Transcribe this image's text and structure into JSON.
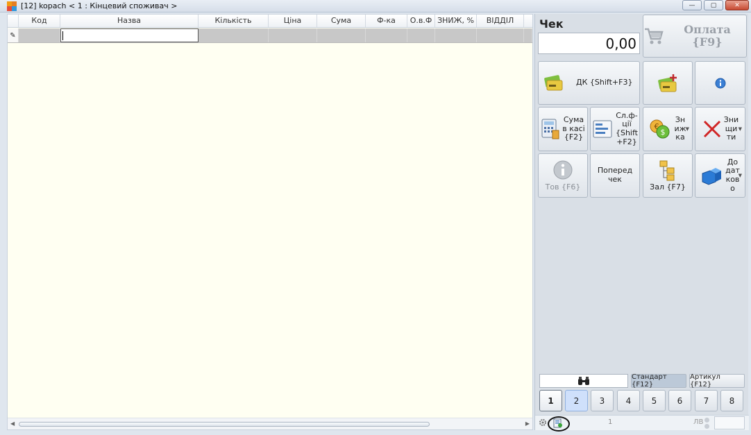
{
  "window": {
    "title": "[12] kopach <    1 : Кінцевий споживач >",
    "minimize_icon": "minimize-icon",
    "maximize_icon": "maximize-icon",
    "close_icon": "close-icon",
    "close_glyph": "✕",
    "minimize_glyph": "—",
    "maximize_glyph": "▢"
  },
  "grid": {
    "columns": [
      "Код",
      "Назва",
      "Кількість",
      "Ціна",
      "Сума",
      "Ф-ка",
      "О.в.Ф",
      "ЗНИЖ, %",
      "ВІДДІЛ"
    ],
    "row_indicator": "✎"
  },
  "panel": {
    "check_label": "Чек",
    "total": "0,00",
    "pay_label": "Оплата {F9}",
    "buttons": {
      "dk": "ДК {Shift+F3}",
      "suma_v_kasi": "Сума\nв касі\n{F2}",
      "sl_fiji": "Сл.ф-\nції\n{Shift\n+F2}",
      "znyzhka": "Зн\nиж\nка",
      "znyshchyty": "Зни\nщи\nти",
      "tov": "Тов {F6}",
      "poperedchek": "Поперед чек",
      "zal": "Зал {F7}",
      "dodatkovo": "До\nдат\nков\nо"
    },
    "mode_standard": "Стандарт {F12}",
    "mode_article": "Артикул {F12}",
    "numbers": [
      "1",
      "2",
      "3",
      "4",
      "5",
      "6",
      "7",
      "8"
    ],
    "status_number": "1",
    "status_lv": "ЛВ"
  },
  "colors": {
    "grid_bg": "#fffff2",
    "panel_bg": "#d9dfe6",
    "row_bg": "#c8c8c8",
    "selected_mode": "#bcc9d8"
  }
}
